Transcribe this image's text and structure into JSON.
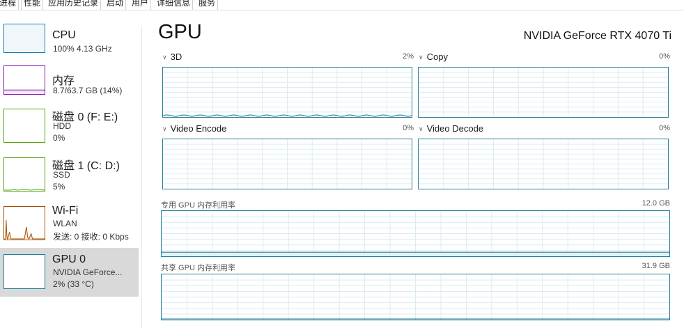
{
  "tabs": [
    {
      "label": "进程",
      "active": false
    },
    {
      "label": "性能",
      "active": true
    },
    {
      "label": "应用历史记录",
      "active": false
    },
    {
      "label": "启动",
      "active": false
    },
    {
      "label": "用户",
      "active": false
    },
    {
      "label": "详细信息",
      "active": false
    },
    {
      "label": "服务",
      "active": false
    }
  ],
  "sidebar": {
    "items": [
      {
        "title": "CPU",
        "line1": "100% 4.13 GHz",
        "line2": "",
        "color": "#117dbb",
        "selected": false
      },
      {
        "title": "内存",
        "line1": "8.7/63.7 GB (14%)",
        "line2": "",
        "color": "#8b12ae",
        "selected": false
      },
      {
        "title": "磁盘 0 (F: E:)",
        "line1": "HDD",
        "line2": "0%",
        "color": "#4da60c",
        "selected": false
      },
      {
        "title": "磁盘 1 (C: D:)",
        "line1": "SSD",
        "line2": "5%",
        "color": "#4da60c",
        "selected": false
      },
      {
        "title": "Wi-Fi",
        "line1": "WLAN",
        "line2": "发送: 0 接收: 0 Kbps",
        "color": "#a74f01",
        "selected": false
      },
      {
        "title": "GPU 0",
        "line1": "NVIDIA GeForce...",
        "line2": "2% (33 °C)",
        "color": "#1f7f99",
        "selected": true
      }
    ]
  },
  "main": {
    "title": "GPU",
    "device_name": "NVIDIA GeForce RTX 4070 Ti",
    "engines": [
      {
        "label": "3D",
        "percent": "2%",
        "utilization": 0.02
      },
      {
        "label": "Copy",
        "percent": "0%",
        "utilization": 0
      },
      {
        "label": "Video Encode",
        "percent": "0%",
        "utilization": 0
      },
      {
        "label": "Video Decode",
        "percent": "0%",
        "utilization": 0
      }
    ],
    "dedicated_memory": {
      "label": "专用 GPU 内存利用率",
      "max": "12.0 GB"
    },
    "shared_memory": {
      "label": "共享 GPU 内存利用率",
      "max": "31.9 GB"
    }
  },
  "colors": {
    "gpu_accent": "#1f7f99",
    "grid": "#d9ecf2",
    "selected_bg": "#d9d9d9"
  }
}
